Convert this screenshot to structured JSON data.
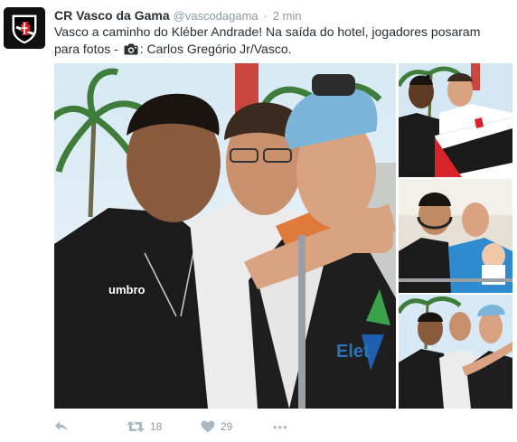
{
  "tweet": {
    "display_name": "CR Vasco da Gama",
    "handle": "@vascodagama",
    "separator": "·",
    "time": "2 min",
    "text_line1": "Vasco a caminho do Kléber Andrade! Na saída do hotel, jogadores posaram",
    "text_line2_before": "para fotos - ",
    "text_line2_after": ": Carlos Gregório Jr/Vasco."
  },
  "media": {
    "main_logo_text": "umbro",
    "shirt_text": "Elet"
  },
  "actions": {
    "retweet_count": "18",
    "like_count": "29",
    "more_label": "•••"
  },
  "icons": {
    "reply": "reply-icon",
    "retweet": "retweet-icon",
    "like": "heart-icon",
    "more": "more-icon",
    "camera": "camera-icon"
  },
  "colors": {
    "text": "#292f33",
    "muted": "#8899a6",
    "action_icon": "#aab8c2"
  }
}
